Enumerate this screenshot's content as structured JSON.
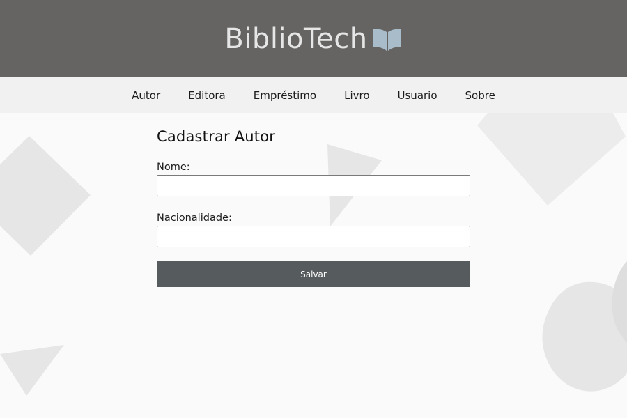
{
  "header": {
    "logo_text": "BiblioTech",
    "logo_icon": "open-book-icon"
  },
  "nav": {
    "items": [
      {
        "label": "Autor"
      },
      {
        "label": "Editora"
      },
      {
        "label": "Empréstimo"
      },
      {
        "label": "Livro"
      },
      {
        "label": "Usuario"
      },
      {
        "label": "Sobre"
      }
    ]
  },
  "form": {
    "title": "Cadastrar Autor",
    "fields": [
      {
        "label": "Nome:",
        "value": ""
      },
      {
        "label": "Nacionalidade:",
        "value": ""
      }
    ],
    "submit_label": "Salvar"
  },
  "colors": {
    "header_bg": "#656463",
    "nav_bg": "#f1f1f1",
    "page_bg": "#fafafa",
    "button_bg": "#565b5d",
    "logo_icon": "#a9bcc9"
  }
}
